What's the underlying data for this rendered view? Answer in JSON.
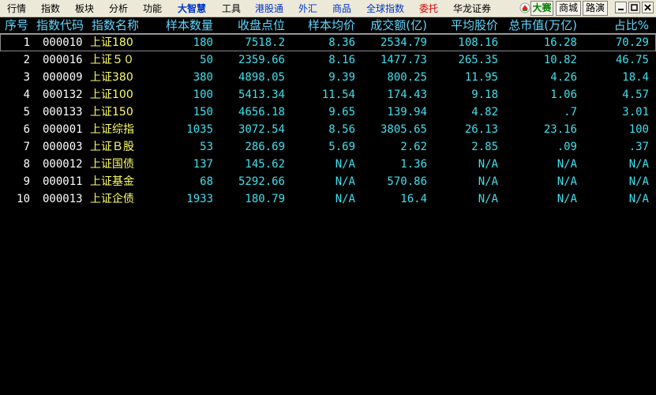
{
  "menu": {
    "items": [
      "行情",
      "指数",
      "板块",
      "分析",
      "功能",
      "大智慧",
      "工具",
      "港股通",
      "外汇",
      "商品",
      "全球指数",
      "委托",
      "华龙证券"
    ],
    "buttons": [
      "大赛",
      "商城",
      "路演"
    ],
    "window_controls": [
      "minimize",
      "restore",
      "close"
    ]
  },
  "columns": [
    "序号",
    "指数代码",
    "指数名称",
    "样本数量",
    "收盘点位",
    "样本均价",
    "成交额(亿)",
    "平均股价",
    "总市值(万亿)",
    "占比%"
  ],
  "rows": [
    {
      "seq": "1",
      "code": "000010",
      "name": "上证180",
      "count": "180",
      "close": "7518.2",
      "avg": "8.36",
      "turnover": "2534.79",
      "avg_price": "108.16",
      "mcap": "16.28",
      "share": "70.29"
    },
    {
      "seq": "2",
      "code": "000016",
      "name": "上证５０",
      "count": "50",
      "close": "2359.66",
      "avg": "8.16",
      "turnover": "1477.73",
      "avg_price": "265.35",
      "mcap": "10.82",
      "share": "46.75"
    },
    {
      "seq": "3",
      "code": "000009",
      "name": "上证380",
      "count": "380",
      "close": "4898.05",
      "avg": "9.39",
      "turnover": "800.25",
      "avg_price": "11.95",
      "mcap": "4.26",
      "share": "18.4"
    },
    {
      "seq": "4",
      "code": "000132",
      "name": "上证100",
      "count": "100",
      "close": "5413.34",
      "avg": "11.54",
      "turnover": "174.43",
      "avg_price": "9.18",
      "mcap": "1.06",
      "share": "4.57"
    },
    {
      "seq": "5",
      "code": "000133",
      "name": "上证150",
      "count": "150",
      "close": "4656.18",
      "avg": "9.65",
      "turnover": "139.94",
      "avg_price": "4.82",
      "mcap": ".7",
      "share": "3.01"
    },
    {
      "seq": "6",
      "code": "000001",
      "name": "上证综指",
      "count": "1035",
      "close": "3072.54",
      "avg": "8.56",
      "turnover": "3805.65",
      "avg_price": "26.13",
      "mcap": "23.16",
      "share": "100"
    },
    {
      "seq": "7",
      "code": "000003",
      "name": "上证Ｂ股",
      "count": "53",
      "close": "286.69",
      "avg": "5.69",
      "turnover": "2.62",
      "avg_price": "2.85",
      "mcap": ".09",
      "share": ".37"
    },
    {
      "seq": "8",
      "code": "000012",
      "name": "上证国债",
      "count": "137",
      "close": "145.62",
      "avg": "N/A",
      "turnover": "1.36",
      "avg_price": "N/A",
      "mcap": "N/A",
      "share": "N/A"
    },
    {
      "seq": "9",
      "code": "000011",
      "name": "上证基金",
      "count": "68",
      "close": "5292.66",
      "avg": "N/A",
      "turnover": "570.86",
      "avg_price": "N/A",
      "mcap": "N/A",
      "share": "N/A"
    },
    {
      "seq": "10",
      "code": "000013",
      "name": "上证企债",
      "count": "1933",
      "close": "180.79",
      "avg": "N/A",
      "turnover": "16.4",
      "avg_price": "N/A",
      "mcap": "N/A",
      "share": "N/A"
    }
  ],
  "colors": {
    "background": "#000000",
    "header_text": "#5ed8ff",
    "name_text": "#ffff66",
    "number_text": "#40e0ee",
    "menu_accent": "#0033cc",
    "menu_alert": "#d40000"
  }
}
